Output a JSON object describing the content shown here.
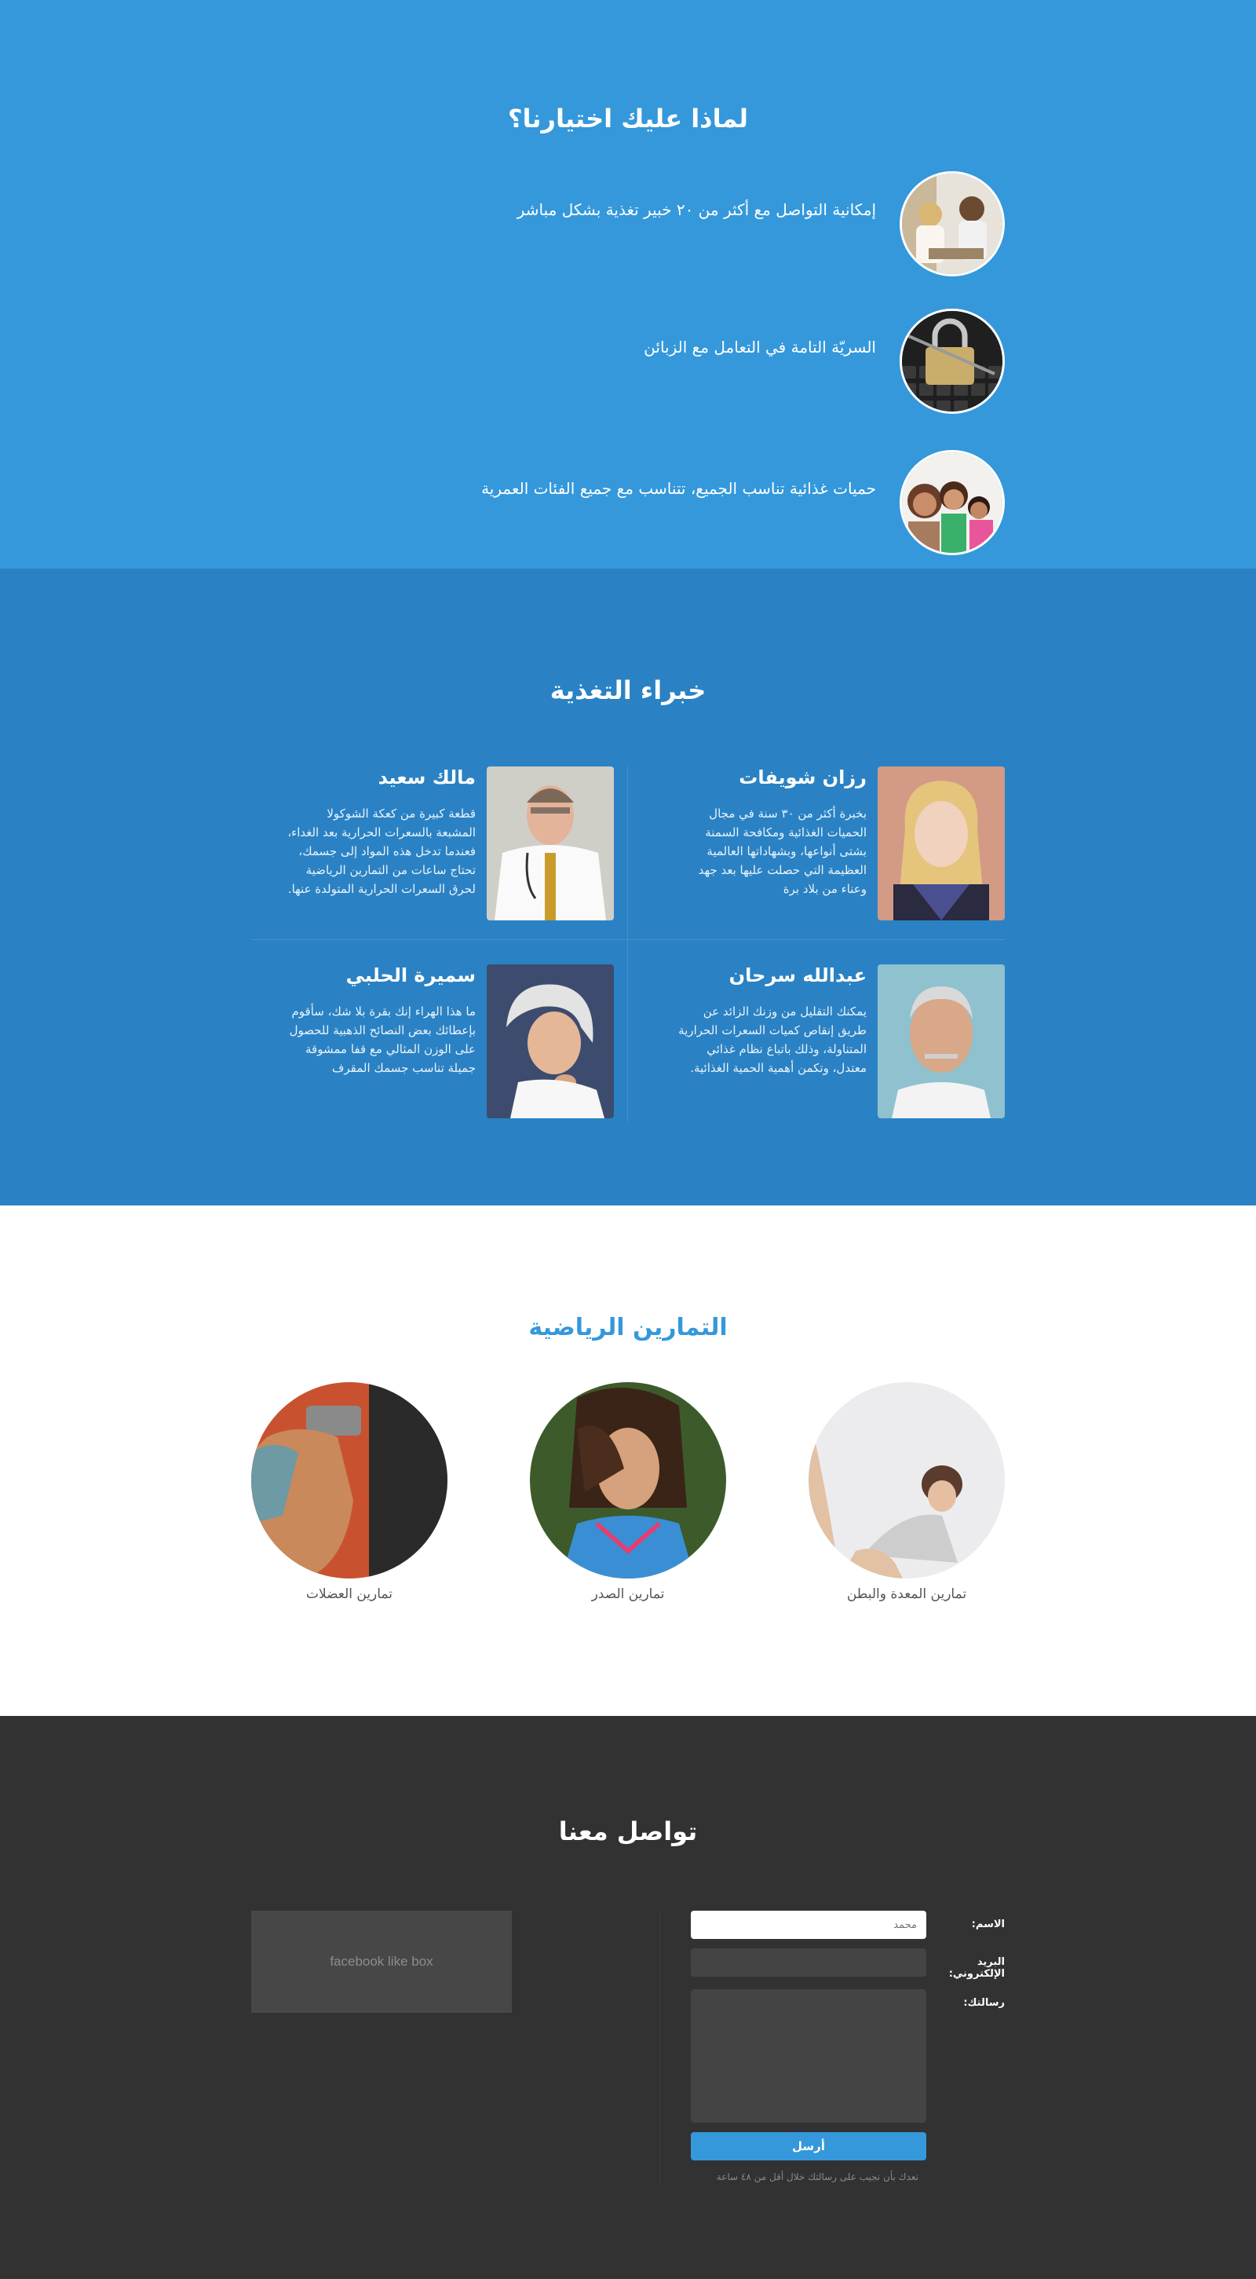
{
  "why_section": {
    "title": "لماذا عليك اختيارنا؟",
    "items": [
      {
        "icon": "nutrition-consultation-photo",
        "text": "إمكانية التواصل مع أكثر من ٢٠ خبير تغذية بشكل مباشر"
      },
      {
        "icon": "privacy-lock-keyboard-photo",
        "text": "السريّة التامة في التعامل مع الزبائن"
      },
      {
        "icon": "family-photo",
        "text": "حميات غذائية تناسب الجميع، تتناسب مع جميع الفئات العمرية"
      }
    ]
  },
  "experts_section": {
    "title": "خبراء التغذية",
    "experts": [
      {
        "name": "رزان شويفات",
        "bio": "بخبرة أكثر من ٣٠ سنة في مجال الحميات الغذائية ومكافحة السمنة بشتى أنواعها، وبشهاداتها العالمية العظيمة التي حصلت عليها بعد جهد وعناء من بلاد برة"
      },
      {
        "name": "مالك سعيد",
        "bio": "قطعة كبيرة من كعكة الشوكولا المشبعة بالسعرات الحرارية بعد الغداء، فعندما تدخل هذه المواد إلى جسمك، تحتاج ساعات من التمارين الرياضية لحرق السعرات الحرارية المتولدة عنها."
      },
      {
        "name": "عبدالله سرحان",
        "bio": "يمكنك التقليل من وزنك الزائد عن طريق إنقاص كميات السعرات الحرارية المتناولة، وذلك باتباع نظام غذائي معتدل، وتكمن أهمية الحمية الغذائية."
      },
      {
        "name": "سميرة الحلبي",
        "bio": "ما هذا الهراء إنك بقرة بلا شك، سأقوم بإعطائك بعض النصائح الذهبية للحصول على الوزن المثالي مع قفا ممشوقة جميلة تناسب جسمك المقرف"
      }
    ]
  },
  "exercises_section": {
    "title": "التمارين الرياضية",
    "items": [
      {
        "label": "تمارين المعدة والبطن"
      },
      {
        "label": "تمارين الصدر"
      },
      {
        "label": "تمارين العضلات"
      }
    ]
  },
  "contact_section": {
    "title": "تواصل معنا",
    "form": {
      "name_label": "الاسم:",
      "name_placeholder": "محمد",
      "email_label": "البريد الإلكتروني:",
      "message_label": "رسالتك:",
      "submit_label": "أرسل",
      "note": "نعدك بأن نجيب على رسالتك خلال أقل من ٤٨ ساعة"
    },
    "facebook_box": "facebook like box"
  },
  "colors": {
    "primary_blue": "#3498db",
    "experts_blue": "#2a82c4",
    "dark_bg": "#323232"
  }
}
